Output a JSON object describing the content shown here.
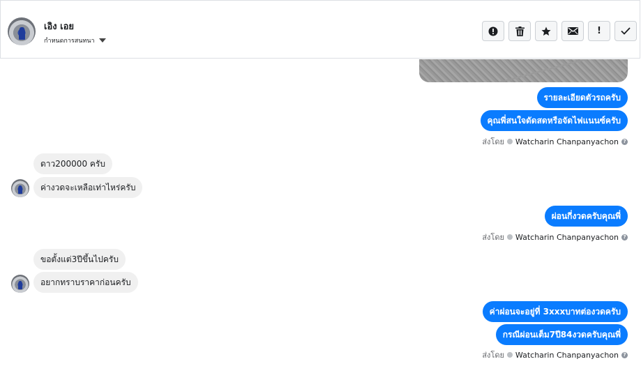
{
  "header": {
    "contact_name": "เอิง เอย",
    "assign_label": "กำหนดการสนทนา",
    "actions": [
      {
        "name": "spam-icon",
        "label": "!"
      },
      {
        "name": "trash-icon",
        "label": ""
      },
      {
        "name": "star-icon",
        "label": ""
      },
      {
        "name": "mail-icon",
        "label": ""
      },
      {
        "name": "exclamation-icon",
        "label": "!"
      },
      {
        "name": "check-icon",
        "label": ""
      }
    ]
  },
  "messages": [
    {
      "dir": "out",
      "text": "รายละเอียดตัวรถครับ"
    },
    {
      "dir": "out",
      "text": "คุณพี่สนใจดัดสดหรือจัดไฟแนนซ์ครับ"
    },
    {
      "dir": "sent_by",
      "prefix": "ส่งโดย",
      "name": "Watcharin Chanpanyachon"
    },
    {
      "dir": "in",
      "text": "ดาว200000 ครับ"
    },
    {
      "dir": "in",
      "text": "ค่างวดจะเหลือเท่าไหร่ครับ"
    },
    {
      "dir": "out",
      "text": "ผ่อนกี่งวดครับคุณพี่"
    },
    {
      "dir": "sent_by",
      "prefix": "ส่งโดย",
      "name": "Watcharin Chanpanyachon"
    },
    {
      "dir": "in",
      "text": "ขอตั้งแต่3ปีขึ้นไปครับ"
    },
    {
      "dir": "in",
      "text": "อยากทราบราคาก่อนครับ"
    },
    {
      "dir": "out",
      "text": "ค่าผ่อนจะอยู่ที่ 3xxxบาทต่องวดครับ"
    },
    {
      "dir": "out",
      "text": "กรณีผ่อนเต็ม7ปี84งวดครับคุณพี่"
    },
    {
      "dir": "sent_by",
      "prefix": "ส่งโดย",
      "name": "Watcharin Chanpanyachon"
    }
  ],
  "colors": {
    "outgoing_bubble": "#0a7cff",
    "incoming_bubble": "#f0f0f0"
  }
}
